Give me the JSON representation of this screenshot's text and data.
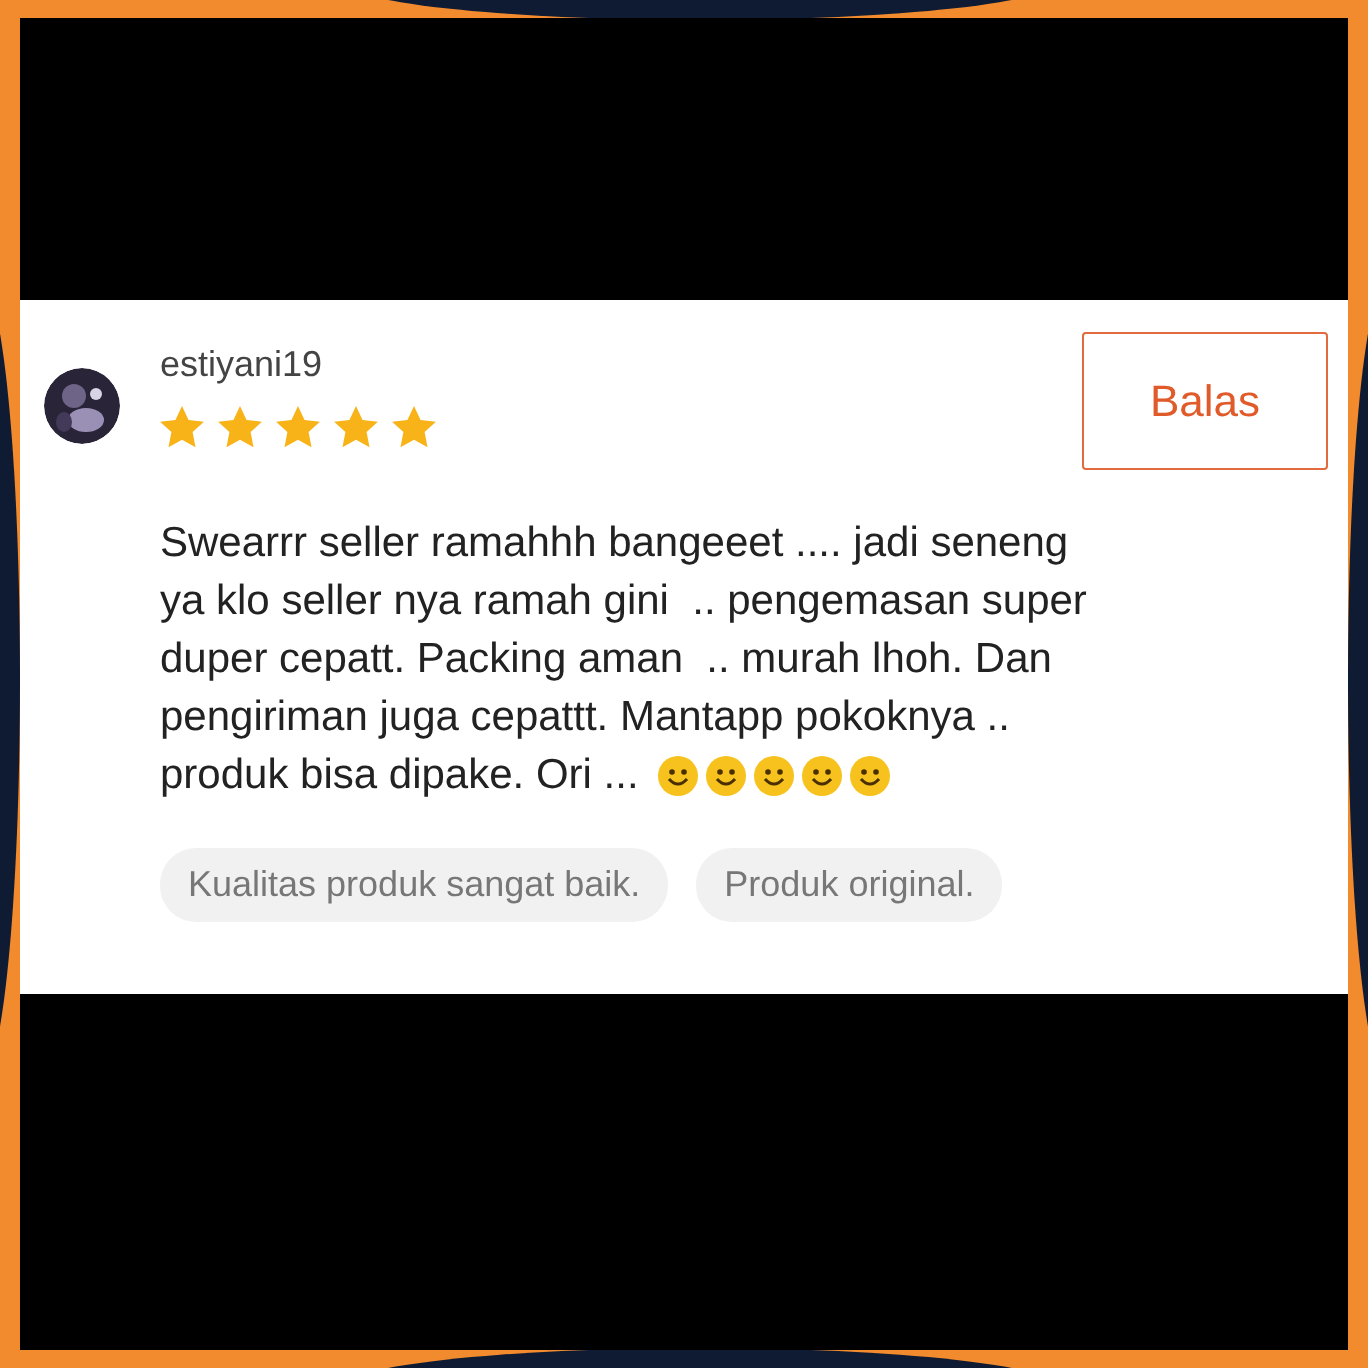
{
  "review": {
    "username": "estiyani19",
    "stars": 5,
    "reply_button": "Balas",
    "text_lines": [
      "Swearrr seller ramahhh bangeeet .... jadi seneng",
      "ya klo seller nya ramah gini  .. pengemasan super",
      "duper cepatt. Packing aman  .. murah lhoh. Dan",
      "pengiriman juga cepattt. Mantapp pokoknya ..",
      "produk bisa dipake. Ori ..."
    ],
    "emojis": [
      {
        "kind": "smiley"
      },
      {
        "kind": "smiley"
      },
      {
        "kind": "smiley"
      },
      {
        "kind": "smiley"
      },
      {
        "kind": "smiley"
      }
    ],
    "tags": [
      "Kualitas produk sangat baik.",
      "Produk original."
    ]
  }
}
